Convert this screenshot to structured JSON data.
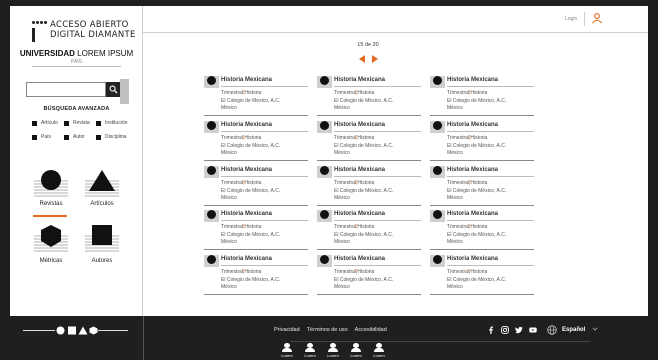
{
  "brand": {
    "title_line1": "ACCESO ABIERTO",
    "title_line2": "DIGITAL DIAMANTE",
    "university_bold": "UNIVERSIDAD",
    "university_light": "LOREM IPSUM",
    "country": "PAÍS"
  },
  "search": {
    "placeholder": "",
    "advanced_label": "BÚSQUEDA AVANZADA",
    "filters": [
      "Artículo",
      "Revista",
      "Institución",
      "País",
      "Autor",
      "Disciplina"
    ]
  },
  "categories": [
    {
      "label": "Revistas",
      "icon": "circle-icon",
      "active": true
    },
    {
      "label": "Artículos",
      "icon": "triangle-icon",
      "active": false
    },
    {
      "label": "Métricas",
      "icon": "hexagon-icon",
      "active": false
    },
    {
      "label": "Autores",
      "icon": "square-icon",
      "active": false
    }
  ],
  "header": {
    "login_label": "Login"
  },
  "pagination": {
    "text": "15 de 20"
  },
  "results": [
    {
      "title": "Historia Mexicana",
      "type": "Trimestral",
      "discipline": "Historia",
      "institution": "El Colegio de México, A.C.",
      "country": "México"
    },
    {
      "title": "Historia Mexicana",
      "type": "Trimestral",
      "discipline": "Historia",
      "institution": "El Colegio de México, A.C.",
      "country": "México"
    },
    {
      "title": "Historia Mexicana",
      "type": "Trimestral",
      "discipline": "Historia",
      "institution": "El Colegio de México, A.C.",
      "country": "México"
    },
    {
      "title": "Historia Mexicana",
      "type": "Trimestral",
      "discipline": "Historia",
      "institution": "El Colegio de México, A.C.",
      "country": "México"
    },
    {
      "title": "Historia Mexicana",
      "type": "Trimestral",
      "discipline": "Historia",
      "institution": "El Colegio de México, A.C.",
      "country": "México"
    },
    {
      "title": "Historia Mexicana",
      "type": "Trimestral",
      "discipline": "Historia",
      "institution": "El Colegio de México, A.C.",
      "country": "México"
    },
    {
      "title": "Historia Mexicana",
      "type": "Trimestral",
      "discipline": "Historia",
      "institution": "El Colegio de México, A.C.",
      "country": "México"
    },
    {
      "title": "Historia Mexicana",
      "type": "Trimestral",
      "discipline": "Historia",
      "institution": "El Colegio de México, A.C.",
      "country": "México"
    },
    {
      "title": "Historia Mexicana",
      "type": "Trimestral",
      "discipline": "Historia",
      "institution": "El Colegio de México, A.C.",
      "country": "México"
    },
    {
      "title": "Historia Mexicana",
      "type": "Trimestral",
      "discipline": "Historia",
      "institution": "El Colegio de México, A.C.",
      "country": "México"
    },
    {
      "title": "Historia Mexicana",
      "type": "Trimestral",
      "discipline": "Historia",
      "institution": "El Colegio de México, A.C.",
      "country": "México"
    },
    {
      "title": "Historia Mexicana",
      "type": "Trimestral",
      "discipline": "Historia",
      "institution": "El Colegio de México, A.C.",
      "country": "México"
    },
    {
      "title": "Historia Mexicana",
      "type": "Trimestral",
      "discipline": "Historia",
      "institution": "El Colegio de México, A.C.",
      "country": "México"
    },
    {
      "title": "Historia Mexicana",
      "type": "Trimestral",
      "discipline": "Historia",
      "institution": "El Colegio de México, A.C.",
      "country": "México"
    },
    {
      "title": "Historia Mexicana",
      "type": "Trimestral",
      "discipline": "Historia",
      "institution": "El Colegio de México, A.C.",
      "country": "México"
    }
  ],
  "footer": {
    "links": [
      "Privacidad",
      "Términos de uso",
      "Accesibilidad"
    ],
    "social": [
      "facebook-icon",
      "instagram-icon",
      "twitter-icon",
      "youtube-icon"
    ],
    "language": "Español",
    "partners": [
      "Lorem",
      "Lorem",
      "Lorem",
      "Lorem",
      "Lorem"
    ]
  },
  "colors": {
    "accent": "#e36a1c",
    "dark": "#1f1f1f"
  }
}
